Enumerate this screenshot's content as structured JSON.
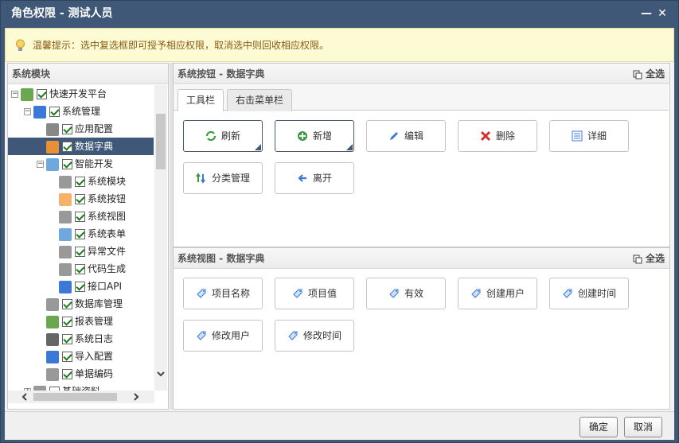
{
  "window": {
    "title": "角色权限 - 测试人员",
    "minimize": "—",
    "close": "✕"
  },
  "tip": {
    "text": "温馨提示：选中复选框即可授予相应权限，取消选中则回收相应权限。"
  },
  "left_panel": {
    "title": "系统模块"
  },
  "tree": [
    {
      "label": "快速开发平台",
      "level": 0,
      "checked": true,
      "expander": "-",
      "icon": "platform-icon",
      "color": "#6aa84f"
    },
    {
      "label": "系统管理",
      "level": 1,
      "checked": true,
      "expander": "-",
      "icon": "gear-icon",
      "color": "#3c78d8"
    },
    {
      "label": "应用配置",
      "level": 2,
      "checked": true,
      "expander": "",
      "icon": "gear-icon",
      "color": "#888888"
    },
    {
      "label": "数据字典",
      "level": 2,
      "checked": true,
      "expander": "",
      "icon": "dictionary-icon",
      "color": "#e69138",
      "selected": true
    },
    {
      "label": "智能开发",
      "level": 2,
      "checked": true,
      "expander": "-",
      "icon": "monitor-icon",
      "color": "#6fa8dc"
    },
    {
      "label": "系统模块",
      "level": 3,
      "checked": true,
      "expander": "",
      "icon": "window-icon",
      "color": "#999999"
    },
    {
      "label": "系统按钮",
      "level": 3,
      "checked": true,
      "expander": "",
      "icon": "buttons-icon",
      "color": "#f6b26b"
    },
    {
      "label": "系统视图",
      "level": 3,
      "checked": true,
      "expander": "",
      "icon": "grid-icon",
      "color": "#999999"
    },
    {
      "label": "系统表单",
      "level": 3,
      "checked": true,
      "expander": "",
      "icon": "form-icon",
      "color": "#6fa8dc"
    },
    {
      "label": "异常文件",
      "level": 3,
      "checked": true,
      "expander": "",
      "icon": "file-icon",
      "color": "#999999"
    },
    {
      "label": "代码生成",
      "level": 3,
      "checked": true,
      "expander": "",
      "icon": "code-icon",
      "color": "#999999"
    },
    {
      "label": "接口API",
      "level": 3,
      "checked": true,
      "expander": "",
      "icon": "api-icon",
      "color": "#3c78d8"
    },
    {
      "label": "数据库管理",
      "level": 2,
      "checked": true,
      "expander": "",
      "icon": "database-icon",
      "color": "#999999"
    },
    {
      "label": "报表管理",
      "level": 2,
      "checked": true,
      "expander": "",
      "icon": "report-icon",
      "color": "#6aa84f"
    },
    {
      "label": "系统日志",
      "level": 2,
      "checked": true,
      "expander": "",
      "icon": "log-icon",
      "color": "#666666"
    },
    {
      "label": "导入配置",
      "level": 2,
      "checked": true,
      "expander": "",
      "icon": "import-icon",
      "color": "#3c78d8"
    },
    {
      "label": "单据编码",
      "level": 2,
      "checked": true,
      "expander": "",
      "icon": "barcode-icon",
      "color": "#999999"
    },
    {
      "label": "基础资料",
      "level": 1,
      "checked": false,
      "expander": "+",
      "icon": "gear-icon",
      "color": "#999999"
    }
  ],
  "buttons_panel": {
    "title": "系统按钮 - 数据字典",
    "select_all": "全选"
  },
  "tabs": [
    {
      "label": "工具栏",
      "active": true
    },
    {
      "label": "右击菜单栏",
      "active": false
    }
  ],
  "toolbar_buttons": [
    {
      "label": "刷新",
      "icon": "refresh-icon",
      "color": "#3d9a3d",
      "checked": true
    },
    {
      "label": "新增",
      "icon": "add-icon",
      "color": "#3d9a3d",
      "checked": true
    },
    {
      "label": "编辑",
      "icon": "pencil-icon",
      "color": "#3c78d8",
      "checked": false
    },
    {
      "label": "删除",
      "icon": "delete-icon",
      "color": "#d33030",
      "checked": false
    },
    {
      "label": "详细",
      "icon": "detail-icon",
      "color": "#3c78d8",
      "checked": false
    },
    {
      "label": "分类管理",
      "icon": "category-icon",
      "color": "#3d9a3d",
      "checked": false
    },
    {
      "label": "离开",
      "icon": "exit-icon",
      "color": "#3c78d8",
      "checked": false
    }
  ],
  "views_panel": {
    "title": "系统视图 - 数据字典",
    "select_all": "全选"
  },
  "view_fields": [
    {
      "label": "项目名称",
      "icon": "tag-icon"
    },
    {
      "label": "项目值",
      "icon": "tag-icon"
    },
    {
      "label": "有效",
      "icon": "tag-icon"
    },
    {
      "label": "创建用户",
      "icon": "tag-icon"
    },
    {
      "label": "创建时间",
      "icon": "tag-icon"
    },
    {
      "label": "修改用户",
      "icon": "tag-icon"
    },
    {
      "label": "修改时间",
      "icon": "tag-icon"
    }
  ],
  "footer": {
    "confirm": "确定",
    "cancel": "取消"
  }
}
